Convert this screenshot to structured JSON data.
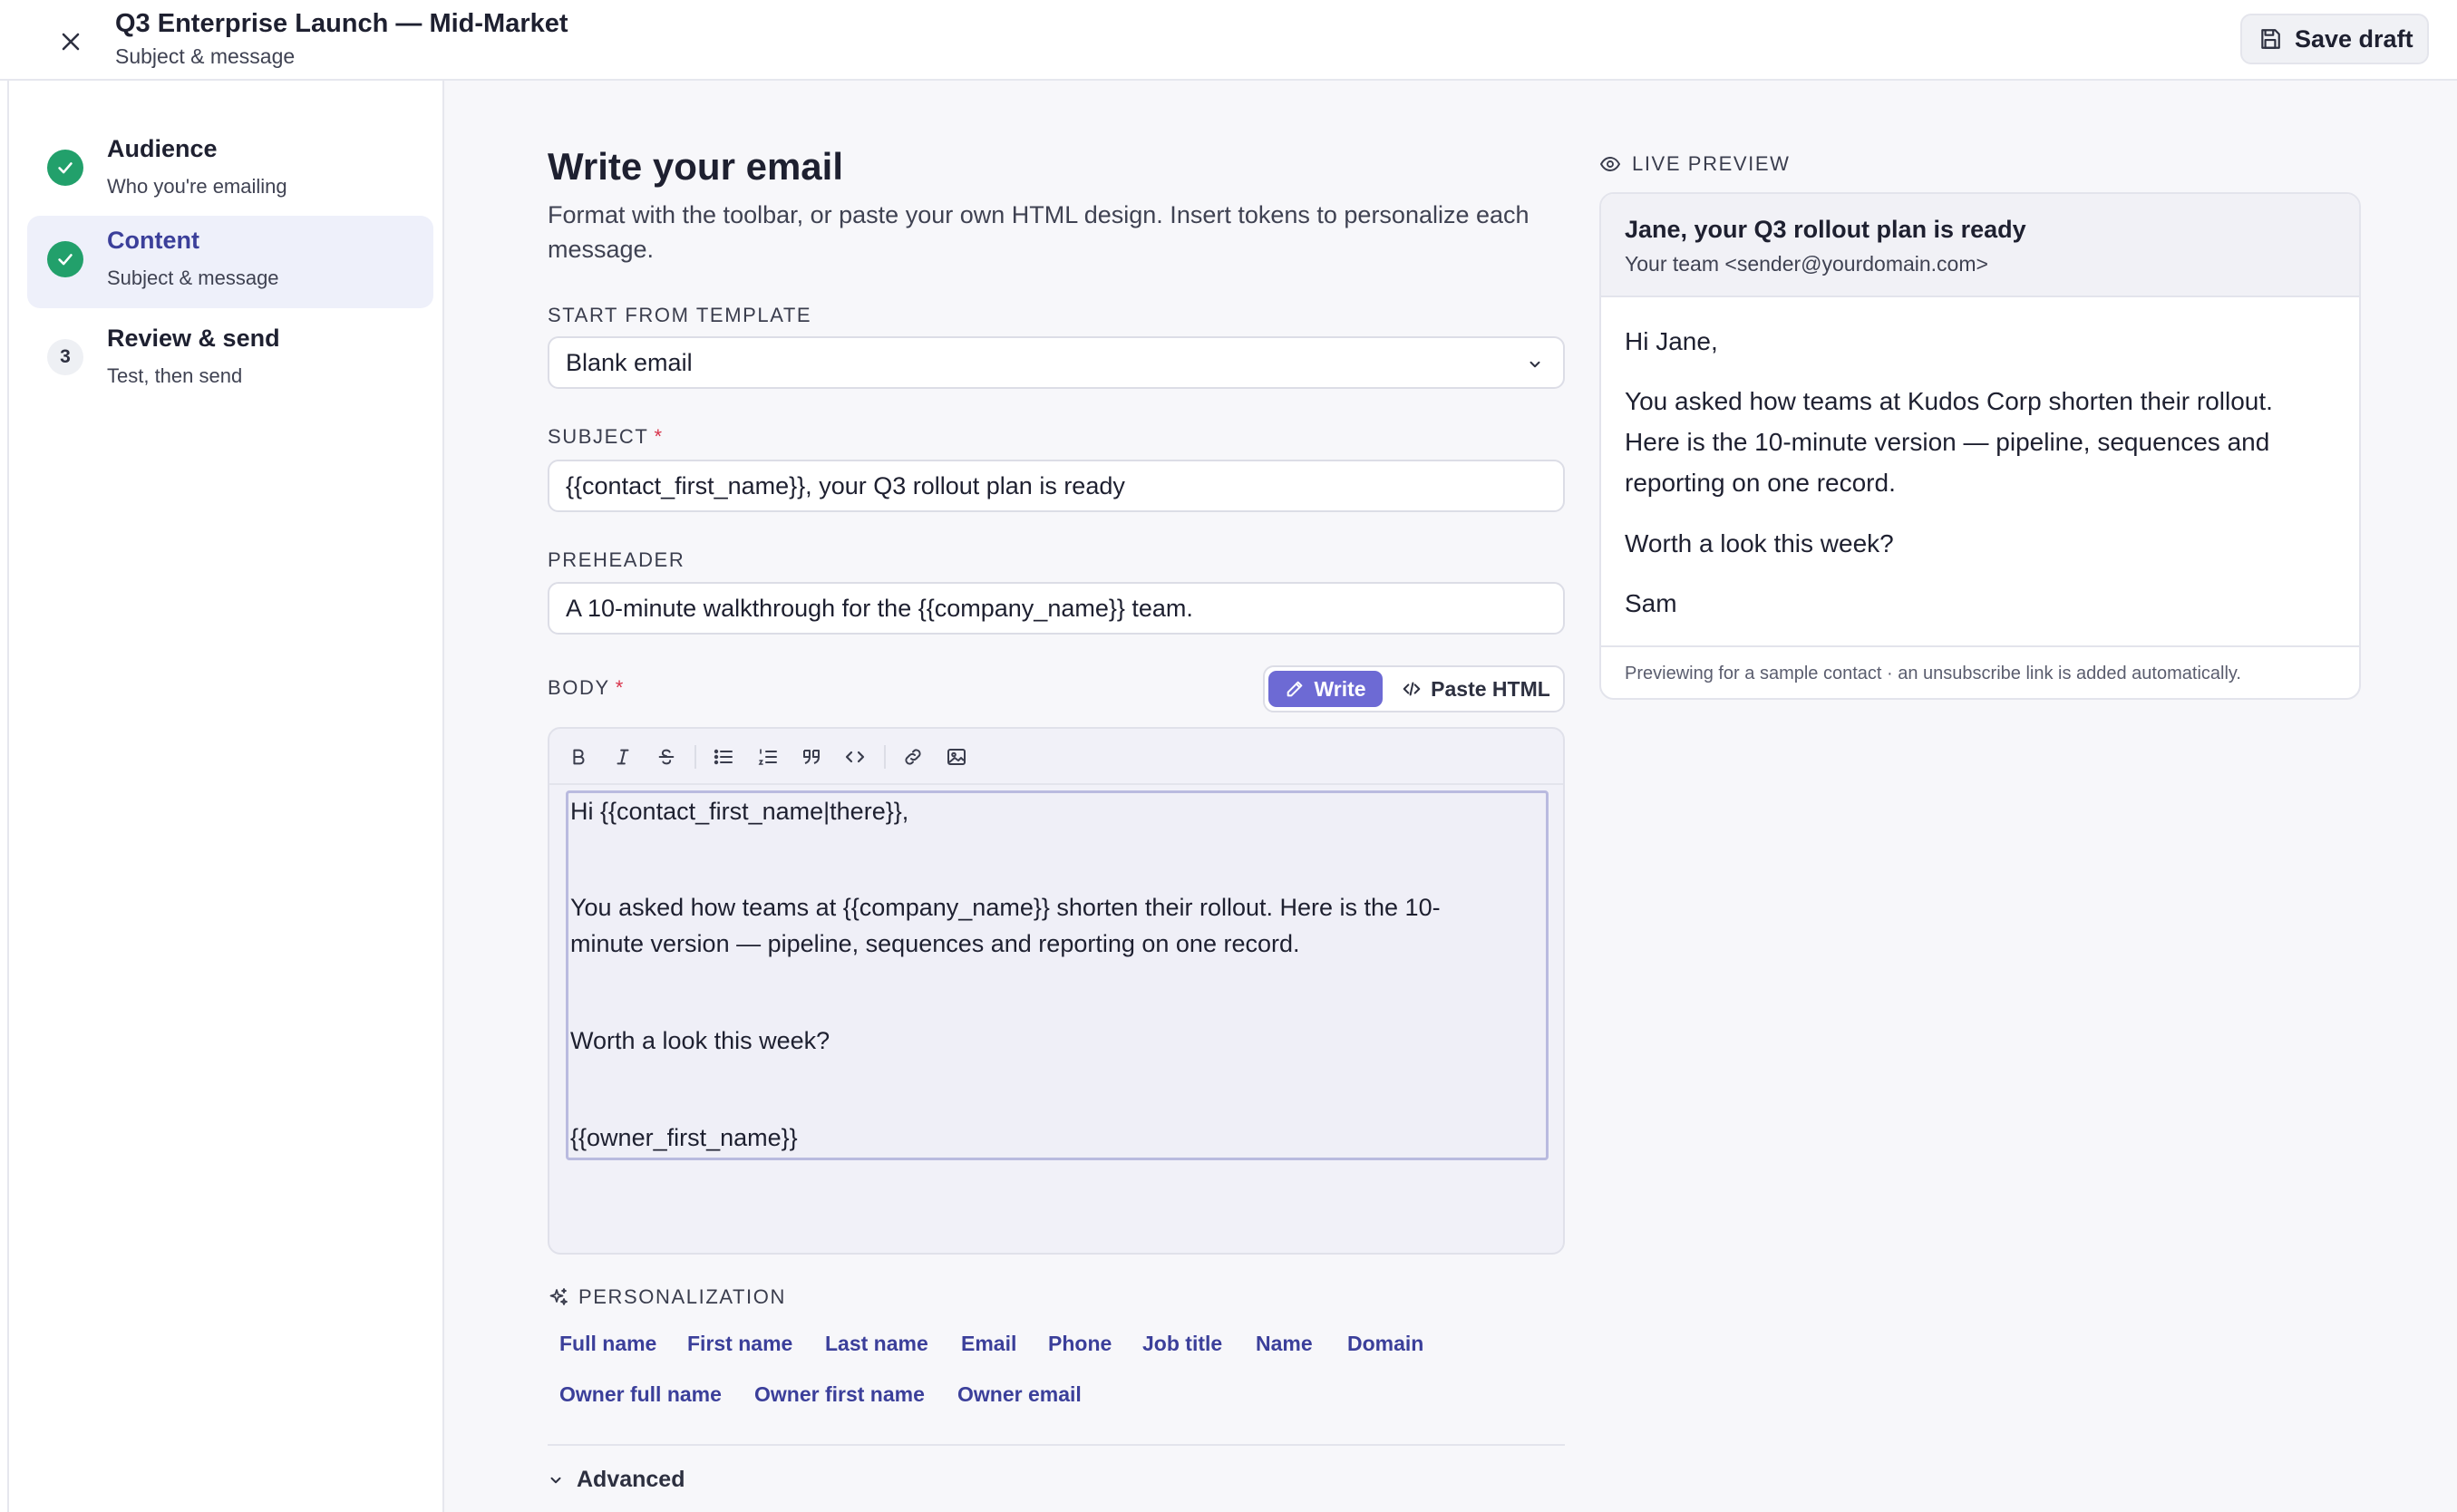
{
  "header": {
    "title": "Q3 Enterprise Launch — Mid-Market",
    "subtitle": "Subject & message",
    "save_label": "Save draft"
  },
  "steps": [
    {
      "title": "Audience",
      "subtitle": "Who you're emailing",
      "state": "done"
    },
    {
      "title": "Content",
      "subtitle": "Subject & message",
      "state": "done-active"
    },
    {
      "number": "3",
      "title": "Review & send",
      "subtitle": "Test, then send",
      "state": "pending"
    }
  ],
  "main": {
    "title": "Write your email",
    "description": "Format with the toolbar, or paste your own HTML design. Insert tokens to personalize each message.",
    "template": {
      "label": "START FROM TEMPLATE",
      "value": "Blank email"
    },
    "subject": {
      "label": "SUBJECT",
      "required_mark": "*",
      "value": "{{contact_first_name}}, your Q3 rollout plan is ready"
    },
    "preheader": {
      "label": "PREHEADER",
      "value": "A 10-minute walkthrough for the {{company_name}} team."
    },
    "body": {
      "label": "BODY",
      "required_mark": "*",
      "mode_write": "Write",
      "mode_html": "Paste HTML",
      "lines": [
        "Hi {{contact_first_name|there}},",
        "You asked how teams at {{company_name}} shorten their rollout. Here is the 10-",
        "minute version — pipeline, sequences and reporting on one record.",
        "Worth a look this week?",
        "{{owner_first_name}}"
      ]
    },
    "personalization": {
      "label": "PERSONALIZATION",
      "tokens": [
        "Full name",
        "First name",
        "Last name",
        "Email",
        "Phone",
        "Job title",
        "Name",
        "Domain",
        "Owner full name",
        "Owner first name",
        "Owner email"
      ]
    },
    "advanced_label": "Advanced"
  },
  "preview": {
    "label": "LIVE PREVIEW",
    "subject": "Jane, your Q3 rollout plan is ready",
    "from": "Your team <sender@yourdomain.com>",
    "lines": [
      "Hi Jane,",
      "You asked how teams at Kudos Corp shorten their rollout.",
      "Here is the 10-minute version — pipeline, sequences and",
      "reporting on one record.",
      "Worth a look this week?",
      "Sam"
    ],
    "footnote": "Previewing for a sample contact · an unsubscribe link is added automatically."
  },
  "colors": {
    "accent": "#6d6ad4",
    "accent_text": "#3b3f9a",
    "success": "#22a06b",
    "required": "#d8334a"
  },
  "icons": {
    "close": "close-icon",
    "save": "floppy-disk-icon",
    "step_done": "check-icon",
    "select": "chevron-down-icon",
    "write": "pencil-icon",
    "paste_html": "code-icon",
    "personalization": "sparkles-icon",
    "preview": "eye-icon",
    "advanced": "chevron-down-icon"
  }
}
